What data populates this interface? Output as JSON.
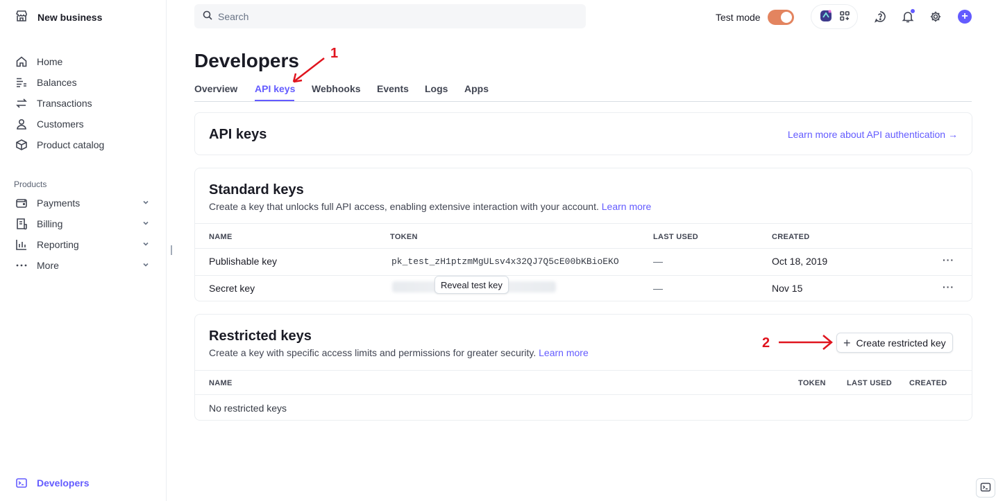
{
  "sidebar": {
    "business_name": "New business",
    "items": [
      {
        "label": "Home",
        "icon": "home-icon"
      },
      {
        "label": "Balances",
        "icon": "balances-icon"
      },
      {
        "label": "Transactions",
        "icon": "transactions-icon"
      },
      {
        "label": "Customers",
        "icon": "customers-icon"
      },
      {
        "label": "Product catalog",
        "icon": "product-catalog-icon"
      }
    ],
    "section_label": "Products",
    "product_items": [
      {
        "label": "Payments",
        "icon": "payments-icon"
      },
      {
        "label": "Billing",
        "icon": "billing-icon"
      },
      {
        "label": "Reporting",
        "icon": "reporting-icon"
      },
      {
        "label": "More",
        "icon": "more-icon"
      }
    ],
    "active_item": "Developers"
  },
  "topbar": {
    "search_placeholder": "Search",
    "test_mode_label": "Test mode",
    "test_mode_on": true
  },
  "page": {
    "title": "Developers",
    "tabs": [
      "Overview",
      "API keys",
      "Webhooks",
      "Events",
      "Logs",
      "Apps"
    ],
    "active_tab": "API keys"
  },
  "api_keys_card": {
    "title": "API keys",
    "learn_link": "Learn more about API authentication →"
  },
  "standard_keys": {
    "title": "Standard keys",
    "description": "Create a key that unlocks full API access, enabling extensive interaction with your account.",
    "learn_more": "Learn more",
    "columns": [
      "NAME",
      "TOKEN",
      "LAST USED",
      "CREATED"
    ],
    "rows": [
      {
        "name": "Publishable key",
        "token": "pk_test_zH1ptzmMgULsv4x32QJ7Q5cE00bKBioEKO",
        "last_used": "—",
        "created": "Oct 18, 2019"
      },
      {
        "name": "Secret key",
        "token_button": "Reveal test key",
        "last_used": "—",
        "created": "Nov 15"
      }
    ],
    "row_menu": "···"
  },
  "restricted_keys": {
    "title": "Restricted keys",
    "description": "Create a key with specific access limits and permissions for greater security.",
    "learn_more": "Learn more",
    "create_button": "Create restricted key",
    "columns": [
      "NAME",
      "TOKEN",
      "LAST USED",
      "CREATED"
    ],
    "empty_text": "No restricted keys"
  },
  "annotations": {
    "step1": "1",
    "step2": "2",
    "color": "#e0141e"
  },
  "colors": {
    "accent": "#635bff",
    "toggle": "#e3845f"
  }
}
